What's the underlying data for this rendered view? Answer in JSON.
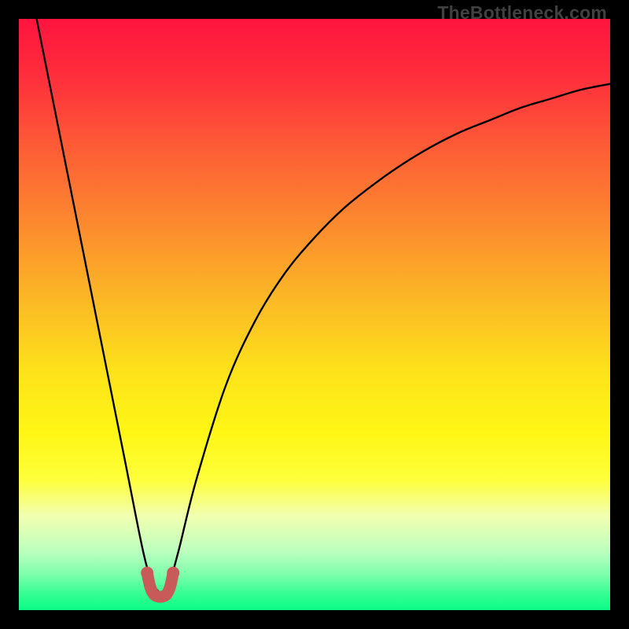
{
  "watermark": "TheBottleneck.com",
  "chart_data": {
    "type": "line",
    "title": "",
    "xlabel": "",
    "ylabel": "",
    "xlim": [
      0,
      100
    ],
    "ylim": [
      0,
      100
    ],
    "grid": false,
    "series": [
      {
        "name": "bottleneck-curve",
        "color": "#000000",
        "x": [
          3,
          6,
          9,
          12,
          15,
          18,
          21,
          22.5,
          24,
          25.5,
          27,
          30,
          35,
          40,
          45,
          50,
          55,
          60,
          65,
          70,
          75,
          80,
          85,
          90,
          95,
          100
        ],
        "y": [
          100,
          85,
          70,
          55,
          40,
          25,
          10,
          5,
          3,
          5,
          10,
          22,
          38,
          49,
          57,
          63,
          68,
          72,
          75.5,
          78.5,
          81,
          83,
          85,
          86.5,
          88,
          89
        ]
      },
      {
        "name": "optimal-range-marker",
        "color": "#c85a5a",
        "x": [
          21.7,
          22.2,
          22.8,
          23.5,
          24.3,
          25.0,
          25.6,
          26.1
        ],
        "y": [
          6.3,
          4.0,
          2.7,
          2.3,
          2.3,
          2.7,
          4.0,
          6.3
        ]
      }
    ],
    "gradient": {
      "stops": [
        {
          "pos": 0.0,
          "color": "#fe143e"
        },
        {
          "pos": 0.1,
          "color": "#fe2f3c"
        },
        {
          "pos": 0.22,
          "color": "#fd5d36"
        },
        {
          "pos": 0.35,
          "color": "#fc8b2e"
        },
        {
          "pos": 0.48,
          "color": "#fbba25"
        },
        {
          "pos": 0.6,
          "color": "#fde31a"
        },
        {
          "pos": 0.7,
          "color": "#fef615"
        },
        {
          "pos": 0.78,
          "color": "#feff3b"
        },
        {
          "pos": 0.84,
          "color": "#f2ffb0"
        },
        {
          "pos": 0.9,
          "color": "#bdffbf"
        },
        {
          "pos": 0.94,
          "color": "#7cfeaa"
        },
        {
          "pos": 0.97,
          "color": "#3bfd96"
        },
        {
          "pos": 0.99,
          "color": "#1afd8c"
        },
        {
          "pos": 1.0,
          "color": "#0dfa87"
        }
      ]
    }
  }
}
